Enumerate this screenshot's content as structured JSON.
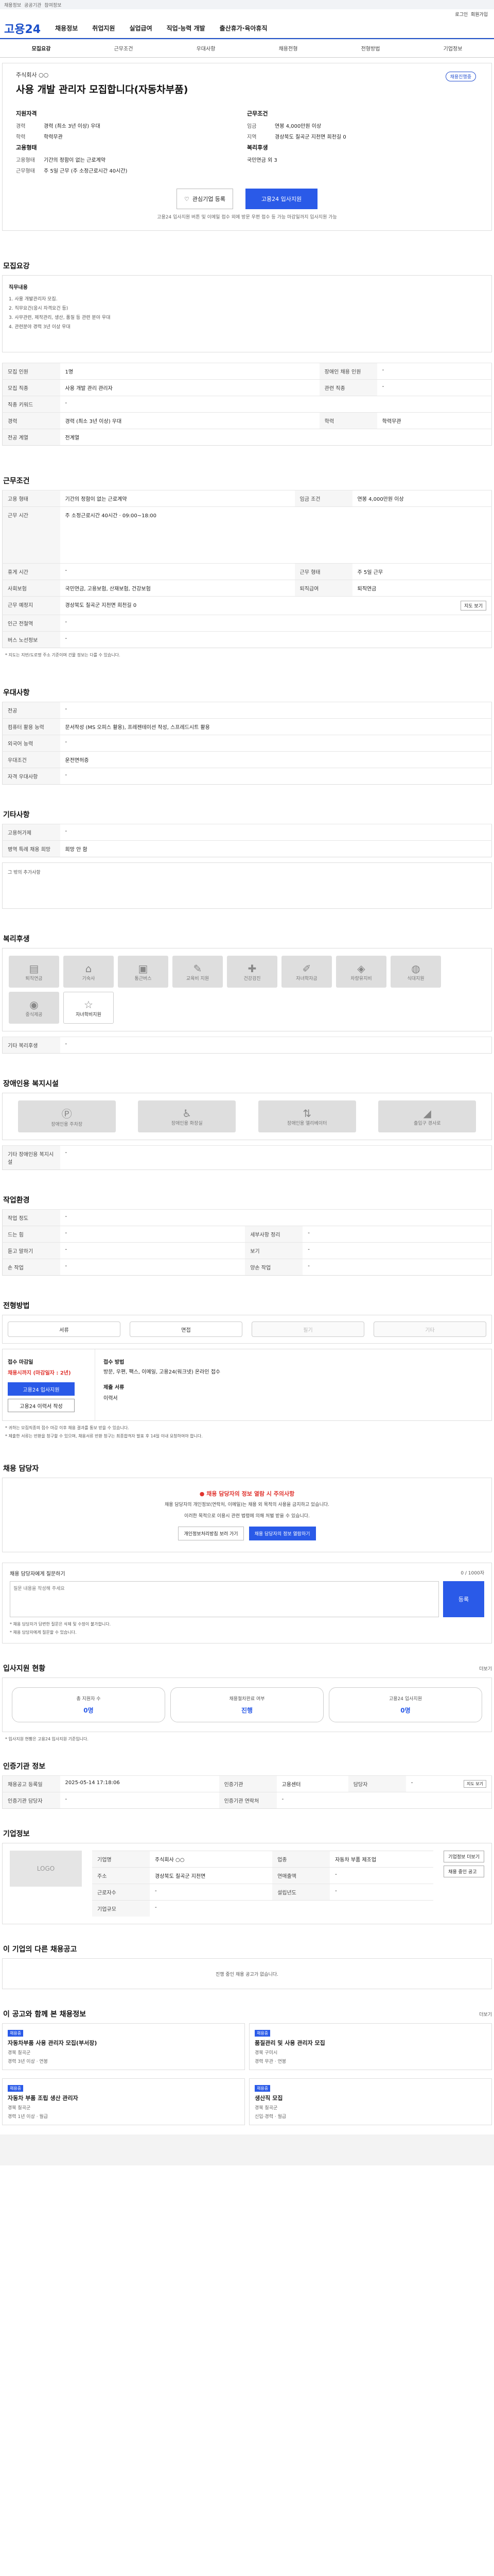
{
  "topbar": {
    "items": [
      "채용정보",
      "공공기관",
      "참여정보",
      "..."
    ],
    "util": [
      "로그인",
      "회원가입"
    ]
  },
  "nav": {
    "logo": "고용24",
    "items": [
      "채용정보",
      "취업지원",
      "실업급여",
      "직업·능력 개발",
      "출산휴가·육아휴직"
    ]
  },
  "subnav": [
    "모집요강",
    "근무조건",
    "우대사항",
    "채용전형",
    "전형방법",
    "기업정보"
  ],
  "summary": {
    "title": "사용 개발 관리자 모집합니다(자동차부품)",
    "company": "주식회사 ○○",
    "badge": "채용진행중",
    "left_head": "지원자격",
    "left_head2": "고용형태",
    "left": [
      {
        "k": "경력",
        "v": "경력 (최소 3년 이상) 우대"
      },
      {
        "k": "학력",
        "v": "학력무관"
      },
      {
        "k": "고용형태",
        "v": "기간의 정함이 없는 근로계약"
      },
      {
        "k": "근무형태",
        "v": "주 5일 근무 (주 소정근로시간 40시간)"
      }
    ],
    "right_head": "근무조건",
    "right_head2": "복리후생",
    "right": [
      {
        "k": "임금",
        "v": "연봉 4,000만원 이상"
      },
      {
        "k": "지역",
        "v": "경상북도 칠곡군 지천면 희천길 0"
      },
      {
        "k": "복리후생",
        "v": "국민연금 외 3"
      }
    ],
    "scrap": "관심기업 등록",
    "apply": "고용24 입사지원",
    "notice": "고용24 입사지원 버튼 및 이메일 접수 외에 방문 우편 접수 등 가능 마감일까지 입사지원 가능"
  },
  "recruit": {
    "title": "모집요강",
    "job_head": "직무내용",
    "job": [
      "1. 사용 개발관리자 모집.",
      "2. 직무요건(응시 자격요건 등)",
      "3. 사무관련, 제작관리, 생산, 품질 등 관련 분야 우대",
      "4. 관련분야 경력 3년 이상 우대"
    ],
    "rows": [
      {
        "k": "모집 인원",
        "v": "1명",
        "k2": "장애인 채용 인원",
        "v2": "-"
      },
      {
        "k": "모집 직종",
        "v": "사용 개발 관리 관리자",
        "k2": "관련 직종",
        "v2": "-"
      },
      {
        "k": "직종 키워드",
        "v": "-",
        "k2": "",
        "v2": ""
      },
      {
        "k": "경력",
        "v": "경력 (최소 3년 이상) 우대",
        "k2": "학력",
        "v2": "학력무관"
      },
      {
        "k": "전공 계열",
        "v": "전계열",
        "k2": "",
        "v2": ""
      }
    ]
  },
  "work": {
    "title": "근무조건",
    "rows": [
      {
        "k": "고용 형태",
        "v": "기간의 정함이 없는 근로계약",
        "k2": "임금 조건",
        "v2": "연봉 4,000만원 이상"
      },
      {
        "k": "근무 시간",
        "v": "주 소정근로시간 40시간 · 09:00~18:00",
        "k2": "",
        "v2": ""
      },
      {
        "k": "휴게 시간",
        "v": "-",
        "k2": "근무 형태",
        "v2": "주 5일 근무"
      },
      {
        "k": "사회보험",
        "v": "국민연금, 고용보험, 산재보험, 건강보험",
        "k2": "퇴직급여",
        "v2": "퇴직연금"
      },
      {
        "k": "근무 예정지",
        "v": "경상북도 칠곡군 지천면 희천길 0",
        "k2": "",
        "v2": ""
      },
      {
        "k": "인근 전철역",
        "v": "-",
        "k2": "",
        "v2": ""
      },
      {
        "k": "버스 노선정보",
        "v": "-",
        "k2": "",
        "v2": ""
      }
    ],
    "map_btn": "지도 보기",
    "footnote": "* 지도는 지번/도로명 주소 기준이며 건물 정보는 다를 수 있습니다."
  },
  "prefer": {
    "title": "우대사항",
    "rows": [
      {
        "k": "전공",
        "v": "-"
      },
      {
        "k": "컴퓨터 활용 능력",
        "v": "문서작성 (MS 오피스 활용), 프레젠테이션 작성, 스프레드시트 활용"
      },
      {
        "k": "외국어 능력",
        "v": "-"
      },
      {
        "k": "우대조건",
        "v": "운전면허증"
      },
      {
        "k": "자격 우대사항",
        "v": "-"
      }
    ]
  },
  "other": {
    "title": "기타사항",
    "rows": [
      {
        "k": "고용허가제",
        "v": "-"
      },
      {
        "k": "병역 특례 채용 희망",
        "v": "희망 안 함"
      }
    ],
    "note": "그 밖의 추가사항"
  },
  "benefit": {
    "title": "복리후생",
    "items": [
      "퇴직연금",
      "기숙사",
      "통근버스",
      "교육비 지원",
      "건강검진",
      "자녀학자금",
      "차량유지비",
      "식대지원",
      "중식제공",
      "자녀학비지원"
    ],
    "on_index": 9,
    "extra_label": "기타 복리후생",
    "extra": "-"
  },
  "disabled": {
    "title": "장애인용 복지시설",
    "items": [
      "장애인용 주차장",
      "장애인용 화장실",
      "장애인용 엘리베이터",
      "출입구 경사로"
    ],
    "extra_label": "기타 장애인용 복지시설",
    "extra": "-"
  },
  "workenv": {
    "title": "작업환경",
    "rows": [
      {
        "k": "작업 정도",
        "v": "-",
        "k2": "",
        "v2": ""
      },
      {
        "k": "드는 힘",
        "v": "-",
        "k2": "세부사항 정리",
        "v2": "-"
      },
      {
        "k": "듣고 말하기",
        "v": "-",
        "k2": "보기",
        "v2": "-"
      },
      {
        "k": "손 작업",
        "v": "-",
        "k2": "양손 작업",
        "v2": "-"
      }
    ]
  },
  "process": {
    "title": "전형방법",
    "steps": [
      "서류",
      "면접",
      "필기",
      "기타"
    ],
    "steps_on": [
      true,
      true,
      false,
      false
    ],
    "deadline_label": "접수 마감일",
    "deadline": "채용시까지 (마감일자 : 2년)",
    "apply_btn": "고용24 입사지원",
    "sub_btn": "고용24 이력서 작성",
    "method_label": "접수 방법",
    "methods": "방문, 우편, 팩스, 이메일, 고용24(워크넷) 온라인 접수",
    "docs_label": "제출 서류",
    "docs": "이력서",
    "notes": [
      "* 귀하는 모집직종의 접수 마감 이후 채용 결과를 통보 받을 수 있습니다.",
      "* 제출한 서류는 반환을 청구할 수 있으며, 채용서류 반환 청구는 최종합격자 발표 후 14일 이내 요청하여야 합니다."
    ]
  },
  "manager": {
    "title": "채용 담당자",
    "warn": "채용 담당자의 정보 열람 시 주의사항",
    "desc1": "채용 담당자의 개인정보(연락처, 이메일)는 채용 외 목적의 사용을 금지하고 있습니다.",
    "desc2": "이러한 목적으로 이용시 관련 법령에 의해 처벌 받을 수 있습니다.",
    "btn1": "개인정보처리방침 보러 가기",
    "btn2": "채용 담당자의 정보 열람하기"
  },
  "qa": {
    "label": "채용 담당자에게 질문하기",
    "count": "0 / 1000자",
    "placeholder": "질문 내용을 작성해 주세요",
    "submit": "등록",
    "notes": [
      "* 채용 담당자가 답변한 질문은 삭제 및 수정이 불가합니다.",
      "* 채용 담당자에게 질문할 수 있습니다."
    ]
  },
  "status": {
    "title": "입사지원 현황",
    "more": "더보기",
    "items": [
      {
        "label": "총 지원자 수",
        "value": "0명"
      },
      {
        "label": "채용절차완료 여부",
        "value": "진행"
      },
      {
        "label": "고용24 입사지원",
        "value": "0명"
      }
    ],
    "note": "* 입사지원 현황은 고용24 입사지원 기준입니다."
  },
  "agency": {
    "title": "인증기관 정보",
    "rows": [
      {
        "k": "채용공고 등록일",
        "v": "2025-05-14 17:18:06",
        "k2": "인증기관",
        "v2": "고용센터",
        "k3": "담당자",
        "v3": "-"
      },
      {
        "k": "인증기관 담당자",
        "v": "-",
        "k2": "인증기관 연락처",
        "v2": "-",
        "k3": "",
        "v3": ""
      }
    ],
    "btn": "지도 보기"
  },
  "company": {
    "title": "기업정보",
    "rows": [
      {
        "k": "기업명",
        "v": "주식회사 ○○",
        "k2": "업종",
        "v2": "자동차 부품 제조업"
      },
      {
        "k": "주소",
        "v": "경상북도 칠곡군 지천면",
        "k2": "연매출액",
        "v2": "-"
      },
      {
        "k": "근로자수",
        "v": "-",
        "k2": "설립년도",
        "v2": "-"
      },
      {
        "k": "기업규모",
        "v": "-",
        "k2": "",
        "v2": ""
      }
    ],
    "logo": "LOGO",
    "btn1": "기업정보 더보기",
    "btn2": "채용 중인 공고"
  },
  "samecompany": {
    "title": "이 기업의 다른 채용공고",
    "empty": "진행 중인 채용 공고가 없습니다."
  },
  "recommend": {
    "title": "이 공고와 함께 본 채용정보",
    "more": "더보기",
    "cards": [
      {
        "tag": "채용중",
        "title": "자동차부품 사용 관리자 모집(부서장)",
        "company": "경북 칠곡군",
        "meta": "경력 3년 이상 · 연봉"
      },
      {
        "tag": "채용중",
        "title": "품질관리 및 사용 관리자 모집",
        "company": "경북 구미시",
        "meta": "경력 무관 · 연봉"
      },
      {
        "tag": "채용중",
        "title": "자동차 부품 조립 생산 관리자",
        "company": "경북 칠곡군",
        "meta": "경력 1년 이상 · 월급"
      },
      {
        "tag": "채용중",
        "title": "생산직 모집",
        "company": "경북 칠곡군",
        "meta": "신입·경력 · 월급"
      }
    ]
  },
  "footer": {
    "text": ""
  }
}
